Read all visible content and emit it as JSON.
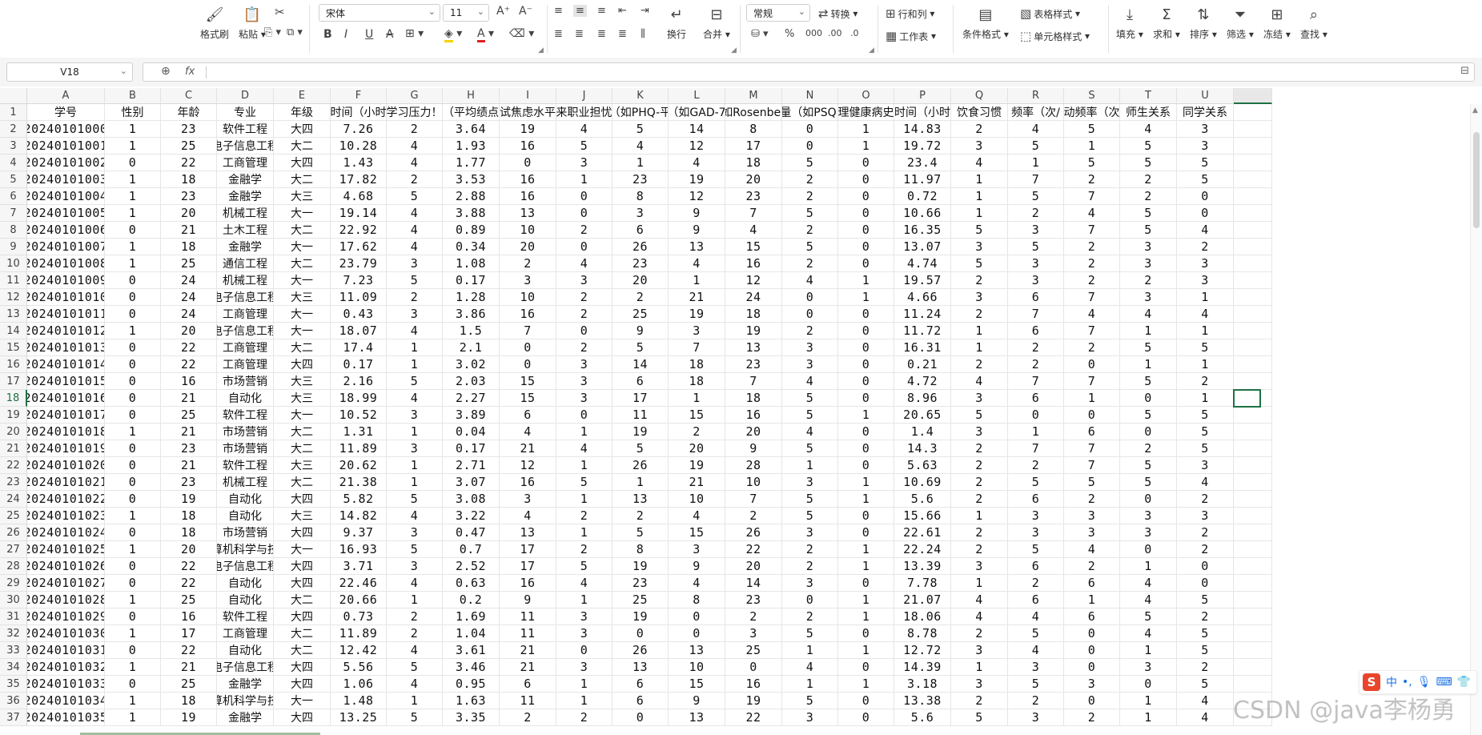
{
  "ribbon": {
    "font_name": "宋体",
    "font_size": "11",
    "number_format": "常规",
    "labels": {
      "format_painter": "格式刷",
      "paste": "粘贴",
      "wrap": "换行",
      "merge": "合并",
      "convert": "转换",
      "row_col": "行和列",
      "worksheet": "工作表",
      "cond_format": "条件格式",
      "table_style": "表格样式",
      "cell_style": "单元格样式",
      "fill": "填充",
      "sum": "求和",
      "sort": "排序",
      "filter": "筛选",
      "freeze": "冻结",
      "find": "查找"
    },
    "icons": [
      "format-painter-icon",
      "paste-icon",
      "cut-icon",
      "bold-icon",
      "italic-icon",
      "underline-icon",
      "strikethrough-icon",
      "border-icon",
      "fill-color-icon",
      "font-color-icon",
      "eraser-icon",
      "align-icon",
      "wrap-icon",
      "merge-icon",
      "convert-icon",
      "row-col-icon",
      "worksheet-icon",
      "conditional-format-icon",
      "table-style-icon",
      "cell-style-icon",
      "fill-icon",
      "sum-icon",
      "sort-icon",
      "filter-icon",
      "freeze-icon",
      "find-icon"
    ]
  },
  "formula_bar": {
    "name_box": "V18",
    "fx_label": "fx",
    "formula": ""
  },
  "sheet": {
    "columns": [
      "A",
      "B",
      "C",
      "D",
      "E",
      "F",
      "G",
      "H",
      "I",
      "J",
      "K",
      "L",
      "M",
      "N",
      "O",
      "P",
      "Q",
      "R",
      "S",
      "T",
      "U"
    ],
    "selected_cell": "V18",
    "selected_row": 18,
    "header_row": [
      "学号",
      "性别",
      "年龄",
      "专业",
      "年级",
      "时间（小时",
      "学习压力！",
      "（平均绩点",
      "试焦虑水平",
      "来职业担忧",
      "（如PHQ-平",
      "（如GAD-7",
      "如Rosenber",
      "量（如PSQI",
      "理健康病史",
      "时间（小时",
      "饮食习惯",
      "频率（次/",
      "动频率（次",
      "师生关系",
      "同学关系"
    ],
    "rows": [
      [
        "20240101000",
        "1",
        "23",
        "软件工程",
        "大四",
        "7.26",
        "2",
        "3.64",
        "19",
        "4",
        "5",
        "14",
        "8",
        "0",
        "1",
        "14.83",
        "2",
        "4",
        "5",
        "4",
        "3"
      ],
      [
        "20240101001",
        "1",
        "25",
        "电子信息工程",
        "大二",
        "10.28",
        "4",
        "1.93",
        "16",
        "5",
        "4",
        "12",
        "17",
        "0",
        "1",
        "19.72",
        "3",
        "5",
        "1",
        "5",
        "3"
      ],
      [
        "20240101002",
        "0",
        "22",
        "工商管理",
        "大四",
        "1.43",
        "4",
        "1.77",
        "0",
        "3",
        "1",
        "4",
        "18",
        "5",
        "0",
        "23.4",
        "4",
        "1",
        "5",
        "5",
        "5"
      ],
      [
        "20240101003",
        "1",
        "18",
        "金融学",
        "大二",
        "17.82",
        "2",
        "3.53",
        "16",
        "1",
        "23",
        "19",
        "20",
        "2",
        "0",
        "11.97",
        "1",
        "7",
        "2",
        "2",
        "5"
      ],
      [
        "20240101004",
        "1",
        "23",
        "金融学",
        "大三",
        "4.68",
        "5",
        "2.88",
        "16",
        "0",
        "8",
        "12",
        "23",
        "2",
        "0",
        "0.72",
        "1",
        "5",
        "7",
        "2",
        "0"
      ],
      [
        "20240101005",
        "1",
        "20",
        "机械工程",
        "大一",
        "19.14",
        "4",
        "3.88",
        "13",
        "0",
        "3",
        "9",
        "7",
        "5",
        "0",
        "10.66",
        "1",
        "2",
        "4",
        "5",
        "0"
      ],
      [
        "20240101006",
        "0",
        "21",
        "土木工程",
        "大二",
        "22.92",
        "4",
        "0.89",
        "10",
        "2",
        "6",
        "9",
        "4",
        "2",
        "0",
        "16.35",
        "5",
        "3",
        "7",
        "5",
        "4"
      ],
      [
        "20240101007",
        "1",
        "18",
        "金融学",
        "大一",
        "17.62",
        "4",
        "0.34",
        "20",
        "0",
        "26",
        "13",
        "15",
        "5",
        "0",
        "13.07",
        "3",
        "5",
        "2",
        "3",
        "2"
      ],
      [
        "20240101008",
        "1",
        "25",
        "通信工程",
        "大二",
        "23.79",
        "3",
        "1.08",
        "2",
        "4",
        "23",
        "4",
        "16",
        "2",
        "0",
        "4.74",
        "5",
        "3",
        "2",
        "3",
        "3"
      ],
      [
        "20240101009",
        "0",
        "24",
        "机械工程",
        "大一",
        "7.23",
        "5",
        "0.17",
        "3",
        "3",
        "20",
        "1",
        "12",
        "4",
        "1",
        "19.57",
        "2",
        "3",
        "2",
        "2",
        "3"
      ],
      [
        "20240101010",
        "0",
        "24",
        "电子信息工程",
        "大三",
        "11.09",
        "2",
        "1.28",
        "10",
        "2",
        "2",
        "21",
        "24",
        "0",
        "1",
        "4.66",
        "3",
        "6",
        "7",
        "3",
        "1"
      ],
      [
        "20240101011",
        "0",
        "24",
        "工商管理",
        "大一",
        "0.43",
        "3",
        "3.86",
        "16",
        "2",
        "25",
        "19",
        "18",
        "0",
        "0",
        "11.24",
        "2",
        "7",
        "4",
        "4",
        "4"
      ],
      [
        "20240101012",
        "1",
        "20",
        "电子信息工程",
        "大一",
        "18.07",
        "4",
        "1.5",
        "7",
        "0",
        "9",
        "3",
        "19",
        "2",
        "0",
        "11.72",
        "1",
        "6",
        "7",
        "1",
        "1"
      ],
      [
        "20240101013",
        "0",
        "22",
        "工商管理",
        "大二",
        "17.4",
        "1",
        "2.1",
        "0",
        "2",
        "5",
        "7",
        "13",
        "3",
        "0",
        "16.31",
        "1",
        "2",
        "2",
        "5",
        "5"
      ],
      [
        "20240101014",
        "0",
        "22",
        "工商管理",
        "大四",
        "0.17",
        "1",
        "3.02",
        "0",
        "3",
        "14",
        "18",
        "23",
        "3",
        "0",
        "0.21",
        "2",
        "2",
        "0",
        "1",
        "1"
      ],
      [
        "20240101015",
        "0",
        "16",
        "市场营销",
        "大三",
        "2.16",
        "5",
        "2.03",
        "15",
        "3",
        "6",
        "18",
        "7",
        "4",
        "0",
        "4.72",
        "4",
        "7",
        "7",
        "5",
        "2"
      ],
      [
        "20240101016",
        "0",
        "21",
        "自动化",
        "大三",
        "18.99",
        "4",
        "2.27",
        "15",
        "3",
        "17",
        "1",
        "18",
        "5",
        "0",
        "8.96",
        "3",
        "6",
        "1",
        "0",
        "1"
      ],
      [
        "20240101017",
        "0",
        "25",
        "软件工程",
        "大一",
        "10.52",
        "3",
        "3.89",
        "6",
        "0",
        "11",
        "15",
        "16",
        "5",
        "1",
        "20.65",
        "5",
        "0",
        "0",
        "5",
        "5"
      ],
      [
        "20240101018",
        "1",
        "21",
        "市场营销",
        "大二",
        "1.31",
        "1",
        "0.04",
        "4",
        "1",
        "19",
        "2",
        "20",
        "4",
        "0",
        "1.4",
        "3",
        "1",
        "6",
        "0",
        "5"
      ],
      [
        "20240101019",
        "0",
        "23",
        "市场营销",
        "大二",
        "11.89",
        "3",
        "0.17",
        "21",
        "4",
        "5",
        "20",
        "9",
        "5",
        "0",
        "14.3",
        "2",
        "7",
        "7",
        "2",
        "5"
      ],
      [
        "20240101020",
        "0",
        "21",
        "软件工程",
        "大三",
        "20.62",
        "1",
        "2.71",
        "12",
        "1",
        "26",
        "19",
        "28",
        "1",
        "0",
        "5.63",
        "2",
        "2",
        "7",
        "5",
        "3"
      ],
      [
        "20240101021",
        "0",
        "23",
        "机械工程",
        "大二",
        "21.38",
        "1",
        "3.07",
        "16",
        "5",
        "1",
        "21",
        "10",
        "3",
        "1",
        "10.69",
        "2",
        "5",
        "5",
        "5",
        "4"
      ],
      [
        "20240101022",
        "0",
        "19",
        "自动化",
        "大四",
        "5.82",
        "5",
        "3.08",
        "3",
        "1",
        "13",
        "10",
        "7",
        "5",
        "1",
        "5.6",
        "2",
        "6",
        "2",
        "0",
        "2"
      ],
      [
        "20240101023",
        "1",
        "18",
        "自动化",
        "大三",
        "14.82",
        "4",
        "3.22",
        "4",
        "2",
        "2",
        "4",
        "2",
        "5",
        "0",
        "15.66",
        "1",
        "3",
        "3",
        "3",
        "3"
      ],
      [
        "20240101024",
        "0",
        "18",
        "市场营销",
        "大四",
        "9.37",
        "3",
        "0.47",
        "13",
        "1",
        "5",
        "15",
        "26",
        "3",
        "0",
        "22.61",
        "2",
        "3",
        "3",
        "3",
        "2"
      ],
      [
        "20240101025",
        "1",
        "20",
        "计算机科学与技术",
        "大一",
        "16.93",
        "5",
        "0.7",
        "17",
        "2",
        "8",
        "3",
        "22",
        "2",
        "1",
        "22.24",
        "2",
        "5",
        "4",
        "0",
        "2"
      ],
      [
        "20240101026",
        "0",
        "22",
        "电子信息工程",
        "大四",
        "3.71",
        "3",
        "2.52",
        "17",
        "5",
        "19",
        "9",
        "20",
        "2",
        "1",
        "13.39",
        "3",
        "6",
        "2",
        "1",
        "0"
      ],
      [
        "20240101027",
        "0",
        "22",
        "自动化",
        "大四",
        "22.46",
        "4",
        "0.63",
        "16",
        "4",
        "23",
        "4",
        "14",
        "3",
        "0",
        "7.78",
        "1",
        "2",
        "6",
        "4",
        "0"
      ],
      [
        "20240101028",
        "1",
        "25",
        "自动化",
        "大二",
        "20.66",
        "1",
        "0.2",
        "9",
        "1",
        "25",
        "8",
        "23",
        "0",
        "1",
        "21.07",
        "4",
        "6",
        "1",
        "4",
        "5"
      ],
      [
        "20240101029",
        "0",
        "16",
        "软件工程",
        "大四",
        "0.73",
        "2",
        "1.69",
        "11",
        "3",
        "19",
        "0",
        "2",
        "2",
        "1",
        "18.06",
        "4",
        "4",
        "6",
        "5",
        "2"
      ],
      [
        "20240101030",
        "1",
        "17",
        "工商管理",
        "大二",
        "11.89",
        "2",
        "1.04",
        "11",
        "3",
        "0",
        "0",
        "3",
        "5",
        "0",
        "8.78",
        "2",
        "5",
        "0",
        "4",
        "5"
      ],
      [
        "20240101031",
        "0",
        "22",
        "自动化",
        "大二",
        "12.42",
        "4",
        "3.61",
        "21",
        "0",
        "26",
        "13",
        "25",
        "1",
        "1",
        "12.72",
        "3",
        "4",
        "0",
        "1",
        "5"
      ],
      [
        "20240101032",
        "1",
        "21",
        "电子信息工程",
        "大四",
        "5.56",
        "5",
        "3.46",
        "21",
        "3",
        "13",
        "10",
        "0",
        "4",
        "0",
        "14.39",
        "1",
        "3",
        "0",
        "3",
        "2"
      ],
      [
        "20240101033",
        "0",
        "25",
        "金融学",
        "大四",
        "1.06",
        "4",
        "0.95",
        "6",
        "1",
        "6",
        "15",
        "16",
        "1",
        "1",
        "3.18",
        "3",
        "5",
        "3",
        "0",
        "5"
      ],
      [
        "20240101034",
        "1",
        "18",
        "计算机科学与技术",
        "大一",
        "1.48",
        "1",
        "1.63",
        "11",
        "1",
        "6",
        "9",
        "19",
        "5",
        "0",
        "13.38",
        "2",
        "2",
        "0",
        "1",
        "4"
      ],
      [
        "20240101035",
        "1",
        "19",
        "金融学",
        "大四",
        "13.25",
        "5",
        "3.35",
        "2",
        "2",
        "0",
        "13",
        "22",
        "3",
        "0",
        "5.6",
        "5",
        "3",
        "2",
        "1",
        "4"
      ]
    ]
  },
  "ime": {
    "logo": "S",
    "mode": "中",
    "punct": "•,",
    "items": [
      "mic-icon",
      "keyboard-icon",
      "shirt-icon"
    ]
  },
  "watermark": "CSDN @java李杨勇"
}
